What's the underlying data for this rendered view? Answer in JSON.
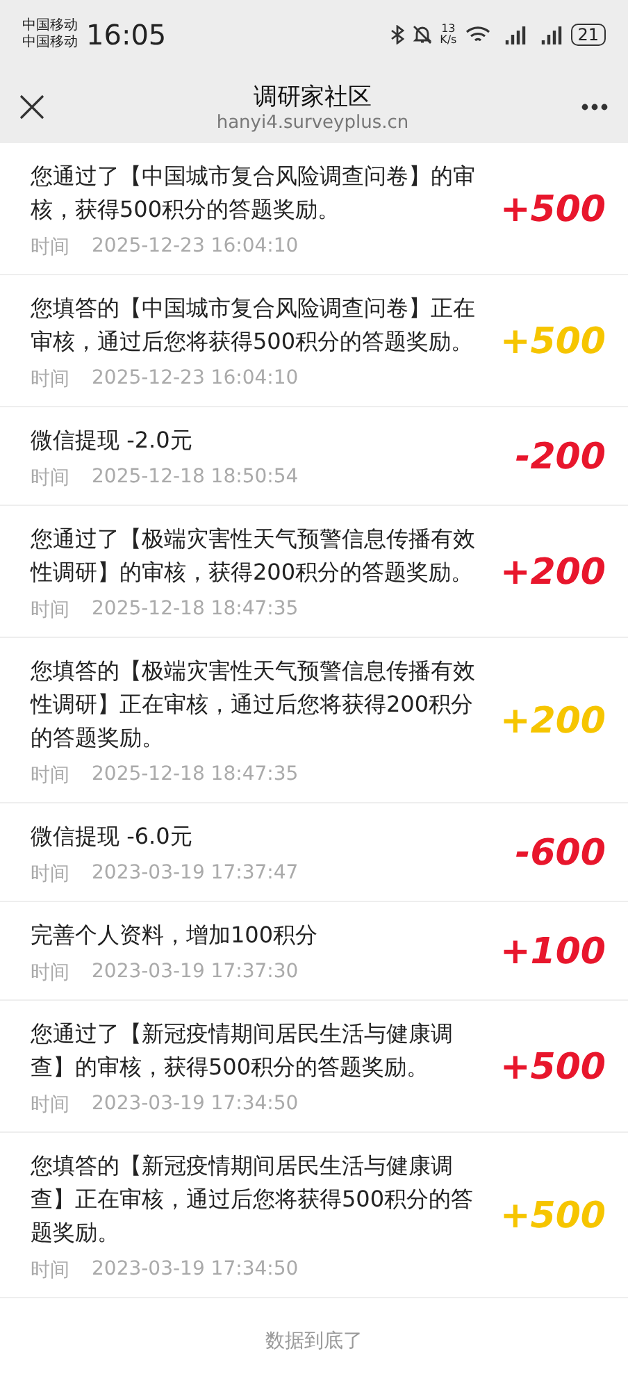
{
  "status_bar": {
    "carriers": [
      "中国移动",
      "中国移动"
    ],
    "time": "16:05",
    "net_speed": "13\nK/s",
    "battery": "21"
  },
  "header": {
    "title": "调研家社区",
    "subtitle": "hanyi4.surveyplus.cn"
  },
  "records": [
    {
      "text": "您通过了【中国城市复合风险调查问卷】的审核，获得500积分的答题奖励。",
      "time_label": "时间",
      "time": "2025-12-23 16:04:10",
      "points": "+500",
      "kind": "earned"
    },
    {
      "text": "您填答的【中国城市复合风险调查问卷】正在审核，通过后您将获得500积分的答题奖励。",
      "time_label": "时间",
      "time": "2025-12-23 16:04:10",
      "points": "+500",
      "kind": "pending"
    },
    {
      "text": "微信提现 -2.0元",
      "time_label": "时间",
      "time": "2025-12-18 18:50:54",
      "points": "-200",
      "kind": "spent"
    },
    {
      "text": "您通过了【极端灾害性天气预警信息传播有效性调研】的审核，获得200积分的答题奖励。",
      "time_label": "时间",
      "time": "2025-12-18 18:47:35",
      "points": "+200",
      "kind": "earned"
    },
    {
      "text": "您填答的【极端灾害性天气预警信息传播有效性调研】正在审核，通过后您将获得200积分的答题奖励。",
      "time_label": "时间",
      "time": "2025-12-18 18:47:35",
      "points": "+200",
      "kind": "pending"
    },
    {
      "text": "微信提现 -6.0元",
      "time_label": "时间",
      "time": "2023-03-19 17:37:47",
      "points": "-600",
      "kind": "spent"
    },
    {
      "text": "完善个人资料，增加100积分",
      "time_label": "时间",
      "time": "2023-03-19 17:37:30",
      "points": "+100",
      "kind": "earned"
    },
    {
      "text": "您通过了【新冠疫情期间居民生活与健康调查】的审核，获得500积分的答题奖励。",
      "time_label": "时间",
      "time": "2023-03-19 17:34:50",
      "points": "+500",
      "kind": "earned"
    },
    {
      "text": "您填答的【新冠疫情期间居民生活与健康调查】正在审核，通过后您将获得500积分的答题奖励。",
      "time_label": "时间",
      "time": "2023-03-19 17:34:50",
      "points": "+500",
      "kind": "pending"
    }
  ],
  "footer": "数据到底了"
}
